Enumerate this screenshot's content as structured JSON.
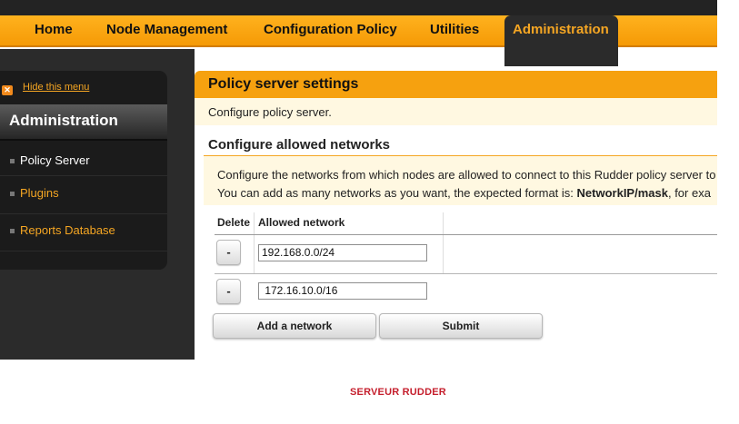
{
  "nav": {
    "items": [
      "Home",
      "Node Management",
      "Configuration Policy",
      "Utilities"
    ],
    "active": "Administration"
  },
  "sidebar": {
    "hide_label": "Hide this menu",
    "hide_icon": "close-icon",
    "title": "Administration",
    "items": [
      {
        "label": "Policy Server",
        "selected": true
      },
      {
        "label": "Plugins",
        "selected": false
      },
      {
        "label": "Reports Database",
        "selected": false
      }
    ]
  },
  "panel": {
    "title": "Policy server settings",
    "subtitle": "Configure policy server."
  },
  "section": {
    "title": "Configure allowed networks",
    "info_line1": "Configure the networks from which nodes are allowed to connect to this Rudder policy server to",
    "info_line2_prefix": "You can add as many networks as you want, the expected format is: ",
    "info_line2_bold": "NetworkIP/mask",
    "info_line2_suffix": ", for exa"
  },
  "table": {
    "headers": {
      "delete": "Delete",
      "network": "Allowed network"
    },
    "rows": [
      {
        "delete_label": "-",
        "network": "192.168.0.0/24"
      },
      {
        "delete_label": "-",
        "network": " 172.16.10.0/16"
      }
    ]
  },
  "buttons": {
    "add_network": "Add a network",
    "submit": "Submit"
  },
  "footer": "SERVEUR RUDDER",
  "colors": {
    "nav_orange": "#f59a06",
    "active_text": "#f5a623",
    "link_orange": "#f5a623",
    "footer_red": "#c51f2d"
  }
}
